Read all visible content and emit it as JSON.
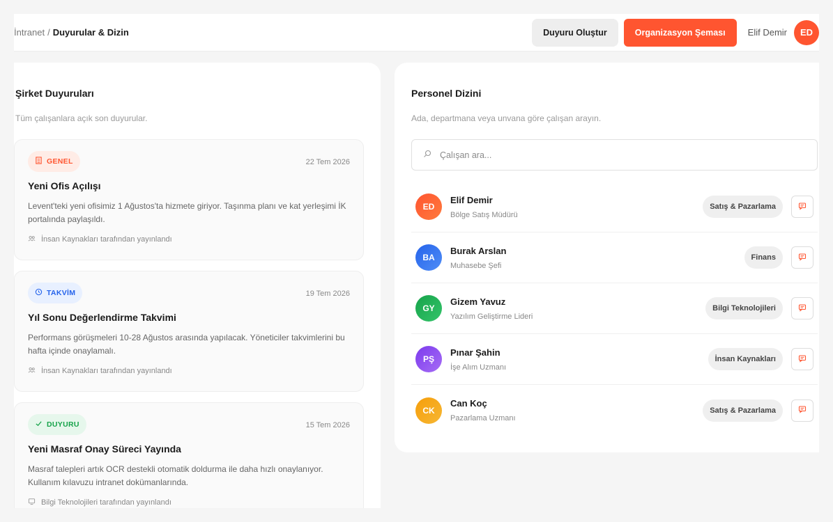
{
  "header": {
    "breadcrumb_root": "İntranet",
    "breadcrumb_sep": "/",
    "breadcrumb_current": "Duyurular & Dizin",
    "create_button": "Duyuru Oluştur",
    "org_button": "Organizasyon Şeması",
    "user_name": "Elif Demir",
    "user_initials": "ED"
  },
  "announcements": {
    "title": "Şirket Duyuruları",
    "subtitle": "Tüm çalışanlara açık son duyurular.",
    "items": [
      {
        "tag": "GENEL",
        "tag_icon": "building-icon",
        "tag_color": "#ff5530",
        "tag_bg": "#ffece6",
        "date": "22 Tem 2026",
        "title": "Yeni Ofis Açılışı",
        "body": "Levent'teki yeni ofisimiz 1 Ağustos'ta hizmete giriyor. Taşınma planı ve kat yerleşimi İK portalında paylaşıldı.",
        "author_icon": "users-icon",
        "author": "İnsan Kaynakları tarafından yayınlandı"
      },
      {
        "tag": "TAKVİM",
        "tag_icon": "clock-icon",
        "tag_color": "#2563eb",
        "tag_bg": "#e8f0ff",
        "date": "19 Tem 2026",
        "title": "Yıl Sonu Değerlendirme Takvimi",
        "body": "Performans görüşmeleri 10-28 Ağustos arasında yapılacak. Yöneticiler takvimlerini bu hafta içinde onaylamalı.",
        "author_icon": "users-icon",
        "author": "İnsan Kaynakları tarafından yayınlandı"
      },
      {
        "tag": "DUYURU",
        "tag_icon": "check-icon",
        "tag_color": "#16a34a",
        "tag_bg": "#e6f7ec",
        "date": "15 Tem 2026",
        "title": "Yeni Masraf Onay Süreci Yayında",
        "body": "Masraf talepleri artık OCR destekli otomatik doldurma ile daha hızlı onaylanıyor. Kullanım kılavuzu intranet dokümanlarında.",
        "author_icon": "monitor-icon",
        "author": "Bilgi Teknolojileri tarafından yayınlandı"
      }
    ]
  },
  "directory": {
    "title": "Personel Dizini",
    "subtitle": "Ada, departmana veya unvana göre çalışan arayın.",
    "search_placeholder": "Çalışan ara...",
    "people": [
      {
        "initials": "ED",
        "name": "Elif Demir",
        "role": "Bölge Satış Müdürü",
        "dept": "Satış & Pazarlama",
        "color_from": "#ff5530",
        "color_to": "#ff7a3d"
      },
      {
        "initials": "BA",
        "name": "Burak Arslan",
        "role": "Muhasebe Şefi",
        "dept": "Finans",
        "color_from": "#2563eb",
        "color_to": "#4f8df6"
      },
      {
        "initials": "GY",
        "name": "Gizem Yavuz",
        "role": "Yazılım Geliştirme Lideri",
        "dept": "Bilgi Teknolojileri",
        "color_from": "#16a34a",
        "color_to": "#34c46a"
      },
      {
        "initials": "PŞ",
        "name": "Pınar Şahin",
        "role": "İşe Alım Uzmanı",
        "dept": "İnsan Kaynakları",
        "color_from": "#7c3aed",
        "color_to": "#a66df5"
      },
      {
        "initials": "CK",
        "name": "Can Koç",
        "role": "Pazarlama Uzmanı",
        "dept": "Satış & Pazarlama",
        "color_from": "#f59e0b",
        "color_to": "#f7b733"
      }
    ]
  }
}
